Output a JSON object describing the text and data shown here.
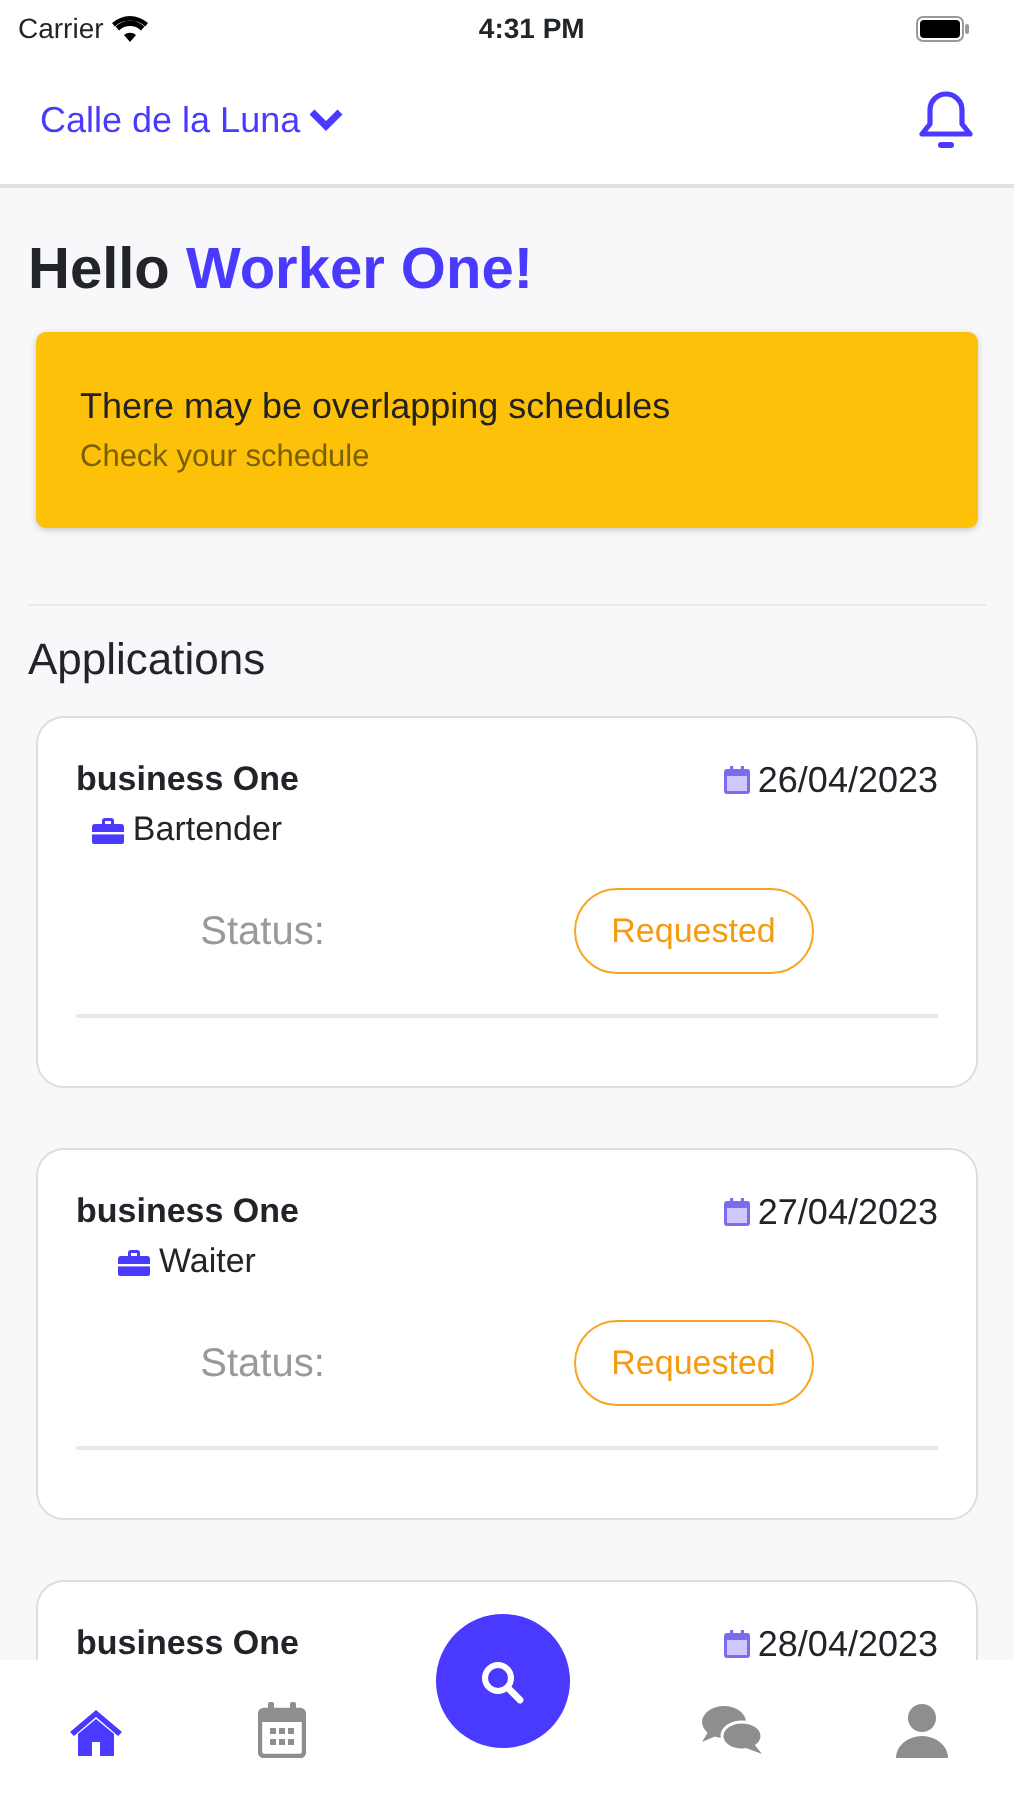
{
  "status_bar": {
    "carrier": "Carrier",
    "time": "4:31 PM"
  },
  "header": {
    "location": "Calle de la Luna"
  },
  "greeting": {
    "text": "Hello",
    "name": "Worker One!"
  },
  "alert": {
    "title": "There may be overlapping schedules",
    "subtitle": "Check your schedule"
  },
  "section_title": "Applications",
  "applications": [
    {
      "business": "business One",
      "role": "Bartender",
      "date": "26/04/2023",
      "status_label": "Status:",
      "status": "Requested"
    },
    {
      "business": "business One",
      "role": "Waiter",
      "date": "27/04/2023",
      "status_label": "Status:",
      "status": "Requested"
    },
    {
      "business": "business One",
      "date": "28/04/2023"
    }
  ],
  "tab_bar": [
    {
      "kind": "home",
      "selected": true
    },
    {
      "kind": "calendar",
      "selected": false
    },
    {
      "kind": "search",
      "selected": false
    },
    {
      "kind": "chat",
      "selected": false
    },
    {
      "kind": "profile",
      "selected": false
    }
  ]
}
